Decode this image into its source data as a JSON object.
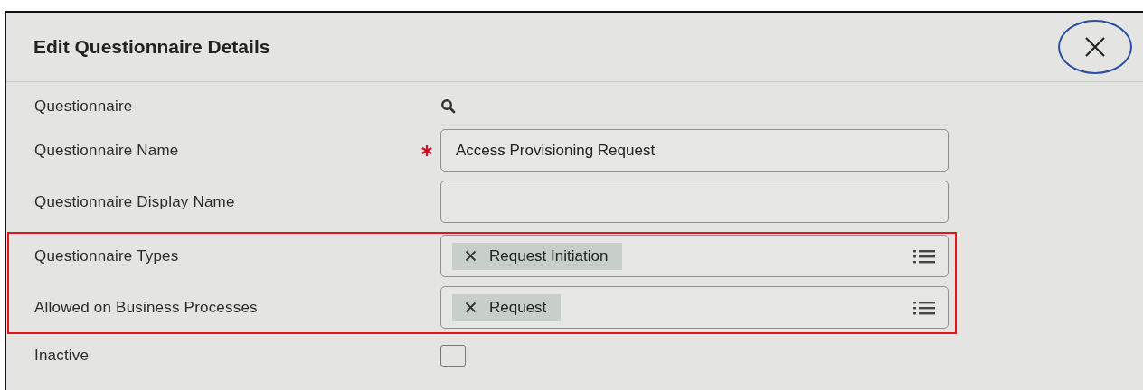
{
  "dialog": {
    "title": "Edit Questionnaire Details"
  },
  "rows": [
    {
      "kind": "lookup",
      "label": "Questionnaire",
      "required": false,
      "highlighted": false
    },
    {
      "kind": "text",
      "label": "Questionnaire Name",
      "required": true,
      "value": "Access Provisioning Request",
      "highlighted": false
    },
    {
      "kind": "text",
      "label": "Questionnaire Display Name",
      "required": false,
      "highlighted": false
    },
    {
      "kind": "multiselect",
      "label": "Questionnaire Types",
      "required": false,
      "chips": [
        "Request Initiation"
      ],
      "highlighted": true
    },
    {
      "kind": "multiselect",
      "label": "Allowed on Business Processes",
      "required": false,
      "chips": [
        "Request"
      ],
      "highlighted": true
    },
    {
      "kind": "checkbox",
      "label": "Inactive",
      "required": false,
      "checked": false,
      "highlighted": false
    }
  ]
}
